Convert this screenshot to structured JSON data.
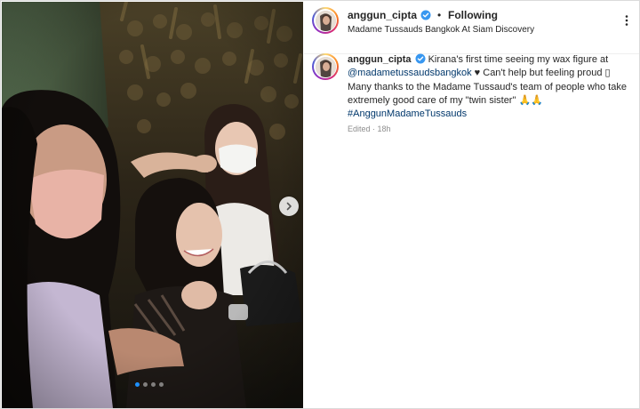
{
  "post": {
    "username": "anggun_cipta",
    "verified": true,
    "separator": "•",
    "follow_status": "Following",
    "location": "Madame Tussauds Bangkok At Siam Discovery"
  },
  "caption": {
    "username": "anggun_cipta",
    "text_1": "Kirana's first time seeing my wax figure at",
    "mention": "@madametussaudsbangkok",
    "text_2": "♥ Can't help but feeling proud",
    "box_char": "▯",
    "text_3": "Many thanks to the Madame Tussaud's team of people who take extremely good care of my \"twin sister\"",
    "emoji": "🙏🙏",
    "hashtag": "#AnggunMadameTussauds",
    "edited_label": "Edited",
    "time_ago": "18h"
  },
  "carousel": {
    "slide_count": 4,
    "current_slide": 1
  },
  "colors": {
    "link": "#00376b",
    "verified_blue": "#3897f0",
    "muted": "#8e8e8e",
    "active_dot": "#1e90ff"
  },
  "icons": [
    "verified-badge-icon",
    "more-options-icon",
    "chevron-right-icon"
  ]
}
